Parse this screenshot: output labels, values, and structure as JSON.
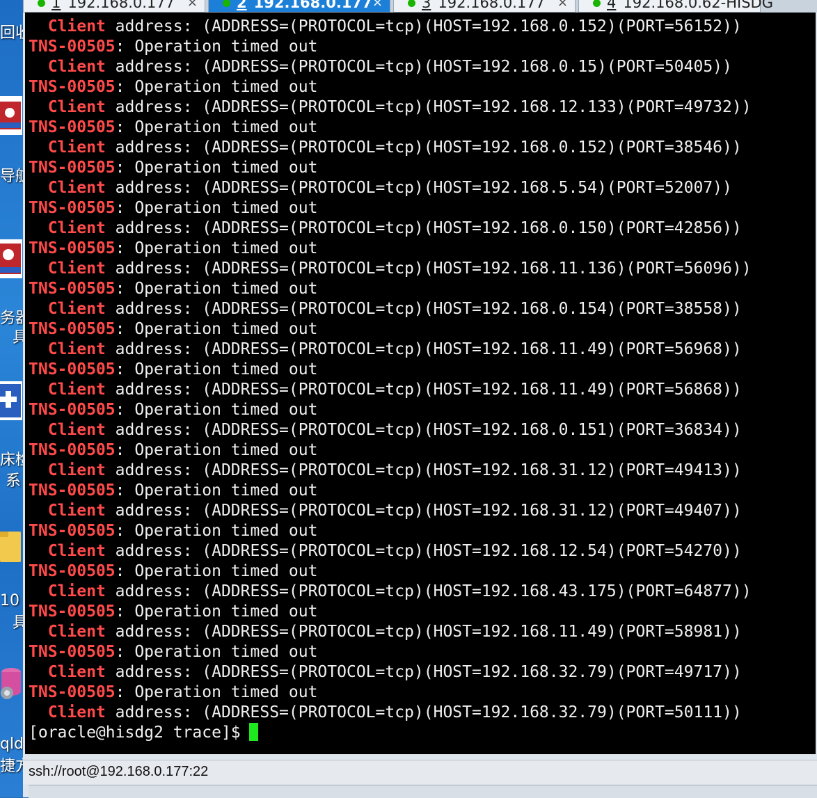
{
  "tabs": [
    {
      "num": "1",
      "label": "192.168.0.177",
      "close": "×"
    },
    {
      "num": "2",
      "label": "192.168.0.177",
      "close": "×"
    },
    {
      "num": "3",
      "label": "192.168.0.177",
      "close": "×"
    },
    {
      "num": "4",
      "label": "192.168.0.62-HISDG",
      "close": ""
    }
  ],
  "desktop": {
    "labels": [
      "回收",
      "导航",
      "务器",
      "具",
      "床检",
      "系",
      "10",
      "具",
      "qld",
      "捷方"
    ]
  },
  "terminal": {
    "lines": [
      {
        "kind": "client",
        "prefix": "  ",
        "key": "Client",
        "text": " address: (ADDRESS=(PROTOCOL=tcp)(HOST=192.168.0.152)(PORT=56152))"
      },
      {
        "kind": "error",
        "prefix": "",
        "key": "TNS-00505",
        "text": ": Operation timed out"
      },
      {
        "kind": "client",
        "prefix": "  ",
        "key": "Client",
        "text": " address: (ADDRESS=(PROTOCOL=tcp)(HOST=192.168.0.15)(PORT=50405))"
      },
      {
        "kind": "error",
        "prefix": "",
        "key": "TNS-00505",
        "text": ": Operation timed out"
      },
      {
        "kind": "client",
        "prefix": "  ",
        "key": "Client",
        "text": " address: (ADDRESS=(PROTOCOL=tcp)(HOST=192.168.12.133)(PORT=49732))"
      },
      {
        "kind": "error",
        "prefix": "",
        "key": "TNS-00505",
        "text": ": Operation timed out"
      },
      {
        "kind": "client",
        "prefix": "  ",
        "key": "Client",
        "text": " address: (ADDRESS=(PROTOCOL=tcp)(HOST=192.168.0.152)(PORT=38546))"
      },
      {
        "kind": "error",
        "prefix": "",
        "key": "TNS-00505",
        "text": ": Operation timed out"
      },
      {
        "kind": "client",
        "prefix": "  ",
        "key": "Client",
        "text": " address: (ADDRESS=(PROTOCOL=tcp)(HOST=192.168.5.54)(PORT=52007))"
      },
      {
        "kind": "error",
        "prefix": "",
        "key": "TNS-00505",
        "text": ": Operation timed out"
      },
      {
        "kind": "client",
        "prefix": "  ",
        "key": "Client",
        "text": " address: (ADDRESS=(PROTOCOL=tcp)(HOST=192.168.0.150)(PORT=42856))"
      },
      {
        "kind": "error",
        "prefix": "",
        "key": "TNS-00505",
        "text": ": Operation timed out"
      },
      {
        "kind": "client",
        "prefix": "  ",
        "key": "Client",
        "text": " address: (ADDRESS=(PROTOCOL=tcp)(HOST=192.168.11.136)(PORT=56096))"
      },
      {
        "kind": "error",
        "prefix": "",
        "key": "TNS-00505",
        "text": ": Operation timed out"
      },
      {
        "kind": "client",
        "prefix": "  ",
        "key": "Client",
        "text": " address: (ADDRESS=(PROTOCOL=tcp)(HOST=192.168.0.154)(PORT=38558))"
      },
      {
        "kind": "error",
        "prefix": "",
        "key": "TNS-00505",
        "text": ": Operation timed out"
      },
      {
        "kind": "client",
        "prefix": "  ",
        "key": "Client",
        "text": " address: (ADDRESS=(PROTOCOL=tcp)(HOST=192.168.11.49)(PORT=56968))"
      },
      {
        "kind": "error",
        "prefix": "",
        "key": "TNS-00505",
        "text": ": Operation timed out"
      },
      {
        "kind": "client",
        "prefix": "  ",
        "key": "Client",
        "text": " address: (ADDRESS=(PROTOCOL=tcp)(HOST=192.168.11.49)(PORT=56868))"
      },
      {
        "kind": "error",
        "prefix": "",
        "key": "TNS-00505",
        "text": ": Operation timed out"
      },
      {
        "kind": "client",
        "prefix": "  ",
        "key": "Client",
        "text": " address: (ADDRESS=(PROTOCOL=tcp)(HOST=192.168.0.151)(PORT=36834))"
      },
      {
        "kind": "error",
        "prefix": "",
        "key": "TNS-00505",
        "text": ": Operation timed out"
      },
      {
        "kind": "client",
        "prefix": "  ",
        "key": "Client",
        "text": " address: (ADDRESS=(PROTOCOL=tcp)(HOST=192.168.31.12)(PORT=49413))"
      },
      {
        "kind": "error",
        "prefix": "",
        "key": "TNS-00505",
        "text": ": Operation timed out"
      },
      {
        "kind": "client",
        "prefix": "  ",
        "key": "Client",
        "text": " address: (ADDRESS=(PROTOCOL=tcp)(HOST=192.168.31.12)(PORT=49407))"
      },
      {
        "kind": "error",
        "prefix": "",
        "key": "TNS-00505",
        "text": ": Operation timed out"
      },
      {
        "kind": "client",
        "prefix": "  ",
        "key": "Client",
        "text": " address: (ADDRESS=(PROTOCOL=tcp)(HOST=192.168.12.54)(PORT=54270))"
      },
      {
        "kind": "error",
        "prefix": "",
        "key": "TNS-00505",
        "text": ": Operation timed out"
      },
      {
        "kind": "client",
        "prefix": "  ",
        "key": "Client",
        "text": " address: (ADDRESS=(PROTOCOL=tcp)(HOST=192.168.43.175)(PORT=64877))"
      },
      {
        "kind": "error",
        "prefix": "",
        "key": "TNS-00505",
        "text": ": Operation timed out"
      },
      {
        "kind": "client",
        "prefix": "  ",
        "key": "Client",
        "text": " address: (ADDRESS=(PROTOCOL=tcp)(HOST=192.168.11.49)(PORT=58981))"
      },
      {
        "kind": "error",
        "prefix": "",
        "key": "TNS-00505",
        "text": ": Operation timed out"
      },
      {
        "kind": "client",
        "prefix": "  ",
        "key": "Client",
        "text": " address: (ADDRESS=(PROTOCOL=tcp)(HOST=192.168.32.79)(PORT=49717))"
      },
      {
        "kind": "error",
        "prefix": "",
        "key": "TNS-00505",
        "text": ": Operation timed out"
      },
      {
        "kind": "client",
        "prefix": "  ",
        "key": "Client",
        "text": " address: (ADDRESS=(PROTOCOL=tcp)(HOST=192.168.32.79)(PORT=50111))"
      }
    ],
    "prompt": "[oracle@hisdg2 trace]$"
  },
  "status": {
    "connection": "ssh://root@192.168.0.177:22"
  },
  "colors": {
    "error_red": "#ff4a4a",
    "cursor_green": "#1ee81e",
    "active_tab": "#1c7fd8",
    "online_dot": "#18b400"
  }
}
